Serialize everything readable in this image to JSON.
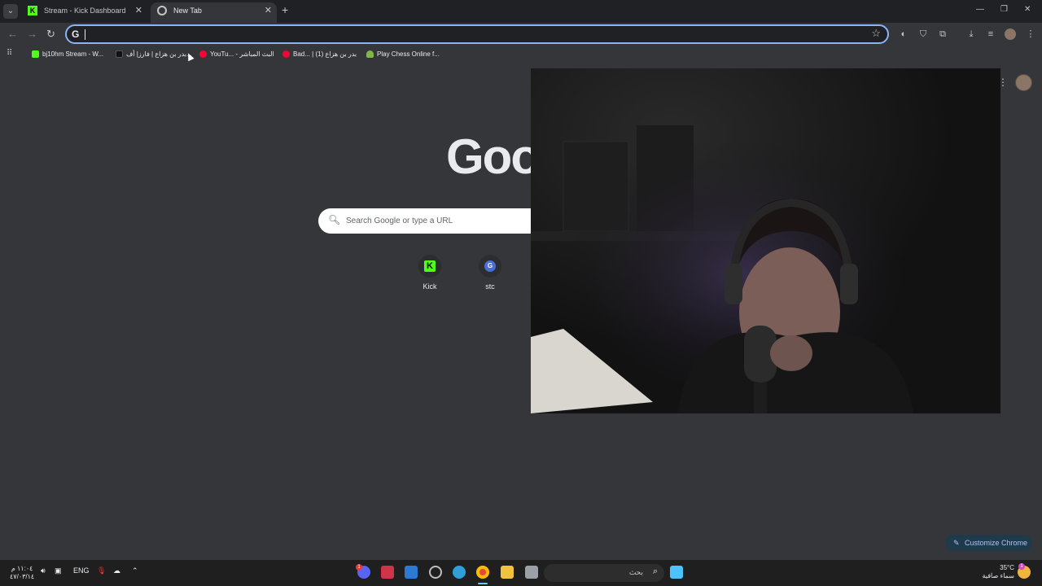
{
  "tabs": [
    {
      "title": "Stream - Kick Dashboard",
      "active": false,
      "favicon": "kick-icon"
    },
    {
      "title": "New Tab",
      "active": true,
      "favicon": "chrome-icon"
    }
  ],
  "toolbar": {
    "address_value": "",
    "omnibox_badge": "G"
  },
  "bookmarks": [
    {
      "label": "bj10hm Stream - W...",
      "icon": "kick-icon",
      "color": "#53fc18"
    },
    {
      "label": "بدر بن هزاع | فارز| أف...",
      "icon": "tiktok-icon",
      "color": "#111111"
    },
    {
      "label": "YouTu... - البث المباشر",
      "icon": "youtube-icon",
      "color": "#ff0033"
    },
    {
      "label": "Bad... | بدر بن هزاع (1)",
      "icon": "youtube-icon",
      "color": "#ff0033"
    },
    {
      "label": "Play Chess Online f...",
      "icon": "chess-pawn-icon",
      "color": "#81b64c"
    }
  ],
  "ntp": {
    "logo_text": "Goo",
    "search_placeholder": "Search Google or type a URL",
    "shortcuts": [
      {
        "label": "Kick",
        "icon": "kick-icon",
        "glyph": "K"
      },
      {
        "label": "stc",
        "icon": "google-g-icon",
        "glyph": "G"
      }
    ],
    "customize_label": "Customize Chrome"
  },
  "taskbar": {
    "time": "١١:٠٤ م",
    "date": "٤٧/٠٣/١٤",
    "language": "ENG",
    "search_placeholder": "بحث",
    "weather_temp": "35°C",
    "weather_desc": "سماء صافية",
    "badge_discord": "1",
    "badge_weather": "1"
  },
  "colors": {
    "kick_green": "#53fc18",
    "accent_blue": "#8ab4f8",
    "page_bg": "#35363a"
  }
}
